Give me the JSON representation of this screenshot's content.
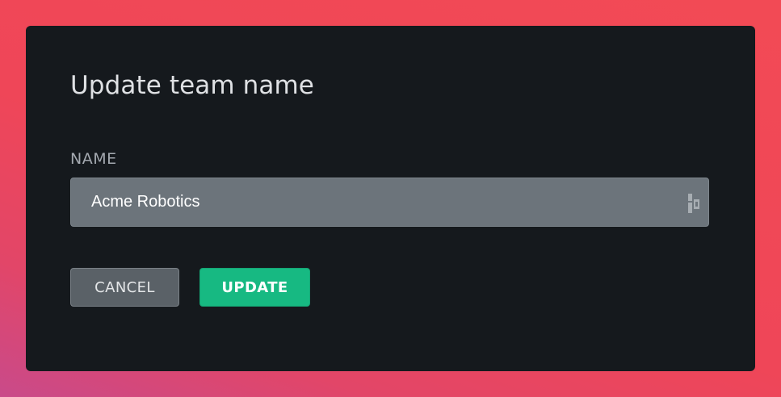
{
  "dialog": {
    "title": "Update team name",
    "name_label": "NAME",
    "name_value": "Acme Robotics",
    "password_manager_icon": "password-manager-icon"
  },
  "actions": {
    "cancel_label": "CANCEL",
    "update_label": "UPDATE"
  },
  "colors": {
    "modal_background": "#15191d",
    "input_background": "#6c747b",
    "cancel_background": "#5a6167",
    "update_background": "#17b982",
    "page_background": "#f04756"
  }
}
